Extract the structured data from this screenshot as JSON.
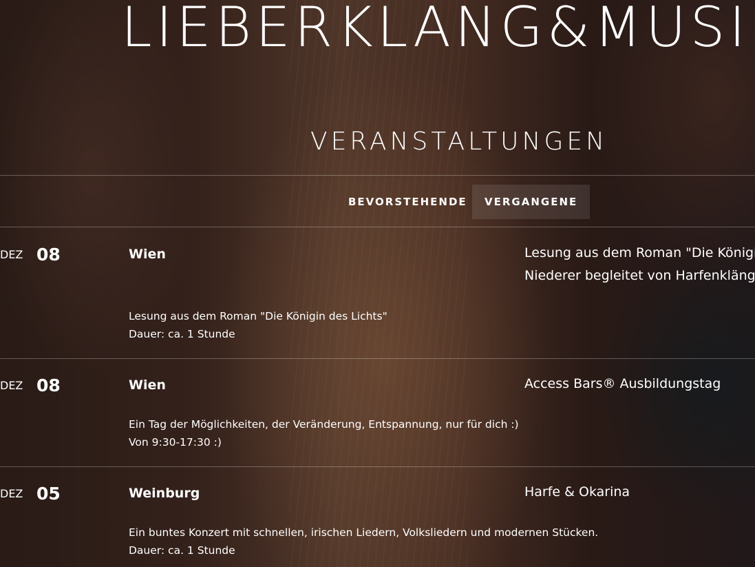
{
  "site": {
    "title": "LIEBERKLANG&MUSI"
  },
  "events_section": {
    "title": "VERANSTALTUNGEN",
    "tabs": [
      {
        "label": "BEVORSTEHENDE",
        "active": false
      },
      {
        "label": "VERGANGENE",
        "active": true
      }
    ],
    "events": [
      {
        "month": "DEZ",
        "day": "08",
        "city": "Wien",
        "name_lines": [
          "Lesung aus dem Roman \"Die Königir",
          "Niederer begleitet von Harfenklänge"
        ],
        "description_lines": [
          "Lesung aus dem Roman \"Die Königin des Lichts\"",
          "Dauer: ca. 1 Stunde"
        ]
      },
      {
        "month": "DEZ",
        "day": "08",
        "city": "Wien",
        "name_lines": [
          "Access Bars® Ausbildungstag"
        ],
        "description_lines": [
          "Ein Tag der Möglichkeiten, der Veränderung, Entspannung, nur für dich :)",
          "Von 9:30-17:30 :)"
        ]
      },
      {
        "month": "DEZ",
        "day": "05",
        "city": "Weinburg",
        "name_lines": [
          "Harfe & Okarina"
        ],
        "description_lines": [
          "Ein buntes Konzert mit schnellen, irischen Liedern, Volksliedern und modernen Stücken.",
          "Dauer: ca. 1 Stunde"
        ]
      }
    ]
  },
  "colors": {
    "text": "#ffffff",
    "active_tab_bg": "rgba(255,255,255,0.10)",
    "divider": "rgba(255,255,255,0.28)"
  }
}
